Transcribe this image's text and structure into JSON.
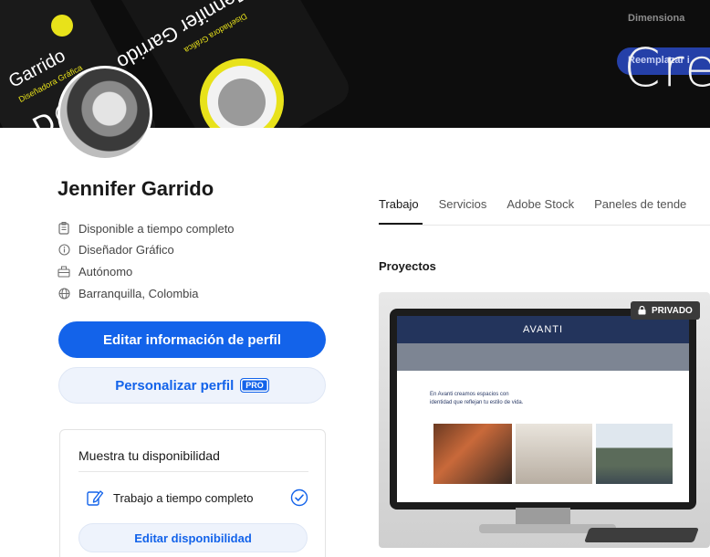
{
  "banner": {
    "left_text": "Jennifer Garrido",
    "right_text": "Cre",
    "pill_text": "Reemplazar i",
    "dim_text": "Dimensiona"
  },
  "profile": {
    "name": "Jennifer Garrido",
    "info": [
      {
        "icon": "briefcase-icon",
        "text": "Disponible a tiempo completo"
      },
      {
        "icon": "info-icon",
        "text": "Diseñador Gráfico"
      },
      {
        "icon": "building-icon",
        "text": "Autónomo"
      },
      {
        "icon": "globe-icon",
        "text": "Barranquilla, Colombia"
      }
    ],
    "edit_button": "Editar información de perfil",
    "customize_button": "Personalizar perfil",
    "pro_badge": "PRO"
  },
  "availability": {
    "title": "Muestra tu disponibilidad",
    "option": "Trabajo a tiempo completo",
    "edit_button": "Editar disponibilidad"
  },
  "tabs": [
    "Trabajo",
    "Servicios",
    "Adobe Stock",
    "Paneles de tende"
  ],
  "active_tab": "Trabajo",
  "projects": {
    "title": "Proyectos",
    "private_badge": "PRIVADO",
    "screen_brand": "AVANTI",
    "screen_text": "En Avanti creamos espacios con identidad que reflejan tu estilo de vida."
  },
  "colors": {
    "primary": "#1363ea",
    "banner": "#0d0d0d",
    "accent_yellow": "#e8e21a"
  }
}
